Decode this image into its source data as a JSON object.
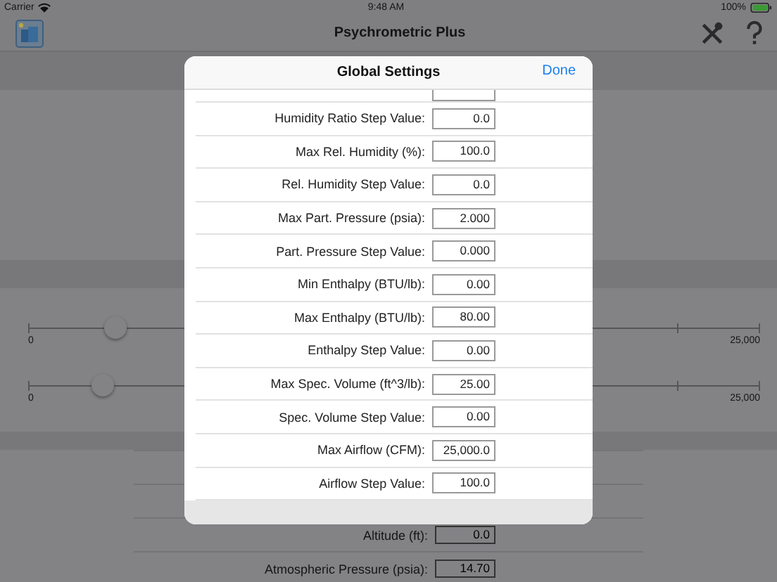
{
  "status_bar": {
    "carrier": "Carrier",
    "time": "9:48 AM",
    "battery": "100%"
  },
  "nav_bar": {
    "title": "Psychrometric Plus"
  },
  "sliders": [
    {
      "min_label": "0",
      "max_label": "25,000",
      "level": 0.115
    },
    {
      "min_label": "0",
      "max_label": "25,000",
      "level": 0.098
    }
  ],
  "background_rows": [
    {
      "label": "Altitude (ft):",
      "value": "0.0"
    },
    {
      "label": "Atmospheric Pressure (psia):",
      "value": "14.70"
    }
  ],
  "dialog": {
    "title": "Global Settings",
    "done": "Done",
    "rows": [
      {
        "label": "Humidity Ratio Step Value:",
        "value": "0.0"
      },
      {
        "label": "Max Rel. Humidity (%):",
        "value": "100.0"
      },
      {
        "label": "Rel. Humidity Step Value:",
        "value": "0.0"
      },
      {
        "label": "Max Part. Pressure (psia):",
        "value": "2.000"
      },
      {
        "label": "Part. Pressure Step Value:",
        "value": "0.000"
      },
      {
        "label": "Min Enthalpy (BTU/lb):",
        "value": "0.00"
      },
      {
        "label": "Max Enthalpy (BTU/lb):",
        "value": "80.00"
      },
      {
        "label": "Enthalpy Step Value:",
        "value": "0.00"
      },
      {
        "label": "Max Spec. Volume (ft^3/lb):",
        "value": "25.00"
      },
      {
        "label": "Spec. Volume Step Value:",
        "value": "0.00"
      },
      {
        "label": "Max Airflow (CFM):",
        "value": "25,000.0"
      },
      {
        "label": "Airflow Step Value:",
        "value": "100.0"
      }
    ]
  }
}
